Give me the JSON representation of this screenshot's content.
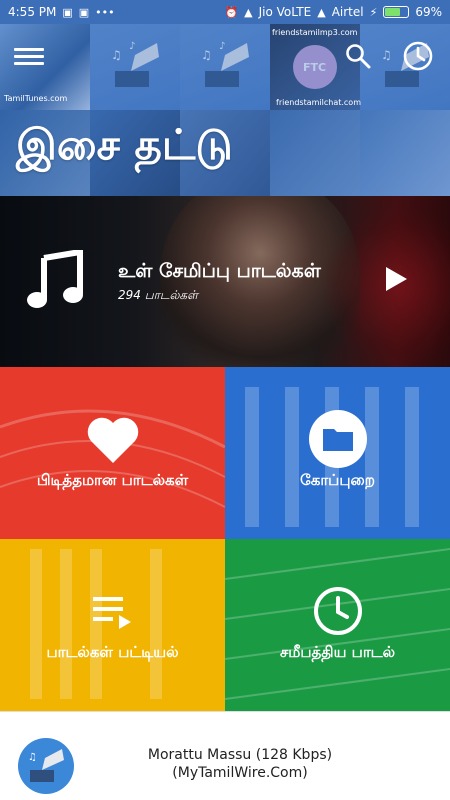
{
  "status_bar": {
    "time": "4:55 PM",
    "carrier1": "Jio VoLTE",
    "carrier2": "Airtel",
    "battery": "69%",
    "battery_level": 0.69
  },
  "header": {
    "title": "இசை தட்டு",
    "tile_label_1": "TamilTunes.com",
    "tile_label_2": "friendstamilmp3.com",
    "tile_label_3": "friendstamilchat.com"
  },
  "banner": {
    "title": "உள் சேமிப்பு பாடல்கள்",
    "subtitle": "294 பாடல்கள்"
  },
  "tiles": {
    "favorites": "பிடித்தமான பாடல்கள்",
    "folders": "கோப்புறை",
    "playlists": "பாடல்கள் பட்டியல்",
    "recent": "சமீபத்திய பாடல்"
  },
  "now_playing": {
    "title": "Morattu Massu (128 Kbps)",
    "subtitle": "(MyTamilWire.Com)"
  },
  "colors": {
    "header_blue": "#3d6fb8",
    "red": "#e53a2c",
    "blue": "#2a6fd0",
    "yellow": "#f1b400",
    "green": "#1b9a44"
  }
}
